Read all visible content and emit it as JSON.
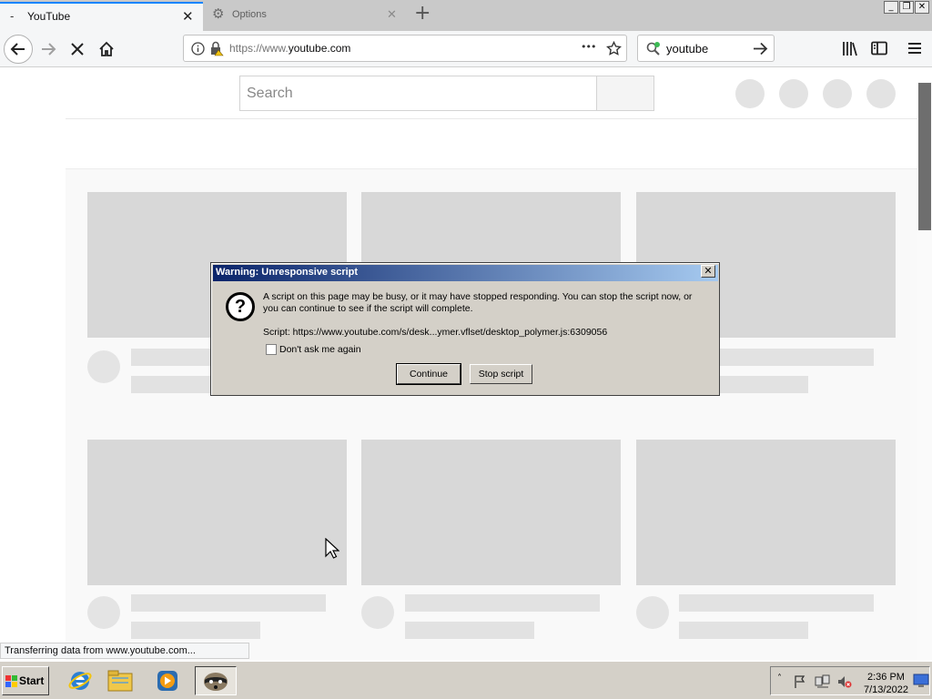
{
  "browser": {
    "tabs": [
      {
        "title": "YouTube",
        "close_label": "✕"
      },
      {
        "title": "Options",
        "close_label": "✕"
      }
    ],
    "new_tab_label": "+",
    "window_controls": {
      "minimize": "_",
      "restore": "❐",
      "close": "✕"
    },
    "url_prefix": "https://www.",
    "url_domain": "youtube.com",
    "url_more": "•••",
    "search_value": "youtube"
  },
  "page": {
    "search_placeholder": "Search"
  },
  "status_text": "Transferring data from www.youtube.com...",
  "dialog": {
    "title": "Warning: Unresponsive script",
    "close_label": "✕",
    "icon_glyph": "?",
    "message": "A script on this page may be busy, or it may have stopped responding. You can stop the script now, or you can continue to see if the script will complete.",
    "script_label": "Script: https://www.youtube.com/s/desk...ymer.vflset/desktop_polymer.js:6309056",
    "checkbox_label": "Don't ask me again",
    "checkbox_checked": false,
    "continue_label": "Continue",
    "stop_label": "Stop script"
  },
  "taskbar": {
    "start_label": "Start",
    "time": "2:36 PM",
    "date": "7/13/2022"
  },
  "icons": [
    "back-icon",
    "forward-icon",
    "stop-icon",
    "home-icon",
    "info-icon",
    "lock-icon",
    "bookmark-star-icon",
    "search-engine-icon",
    "search-go-icon",
    "library-icon",
    "sidebar-icon",
    "menu-icon",
    "gear-icon",
    "question-icon",
    "ie-icon",
    "explorer-icon",
    "media-player-icon",
    "app-icon",
    "windows-flag-icon"
  ],
  "colors": {
    "accent": "#0a84ff",
    "dialog_title_start": "#0a246a",
    "dialog_title_end": "#a6caf0",
    "skeleton": "#d8d8d8"
  }
}
